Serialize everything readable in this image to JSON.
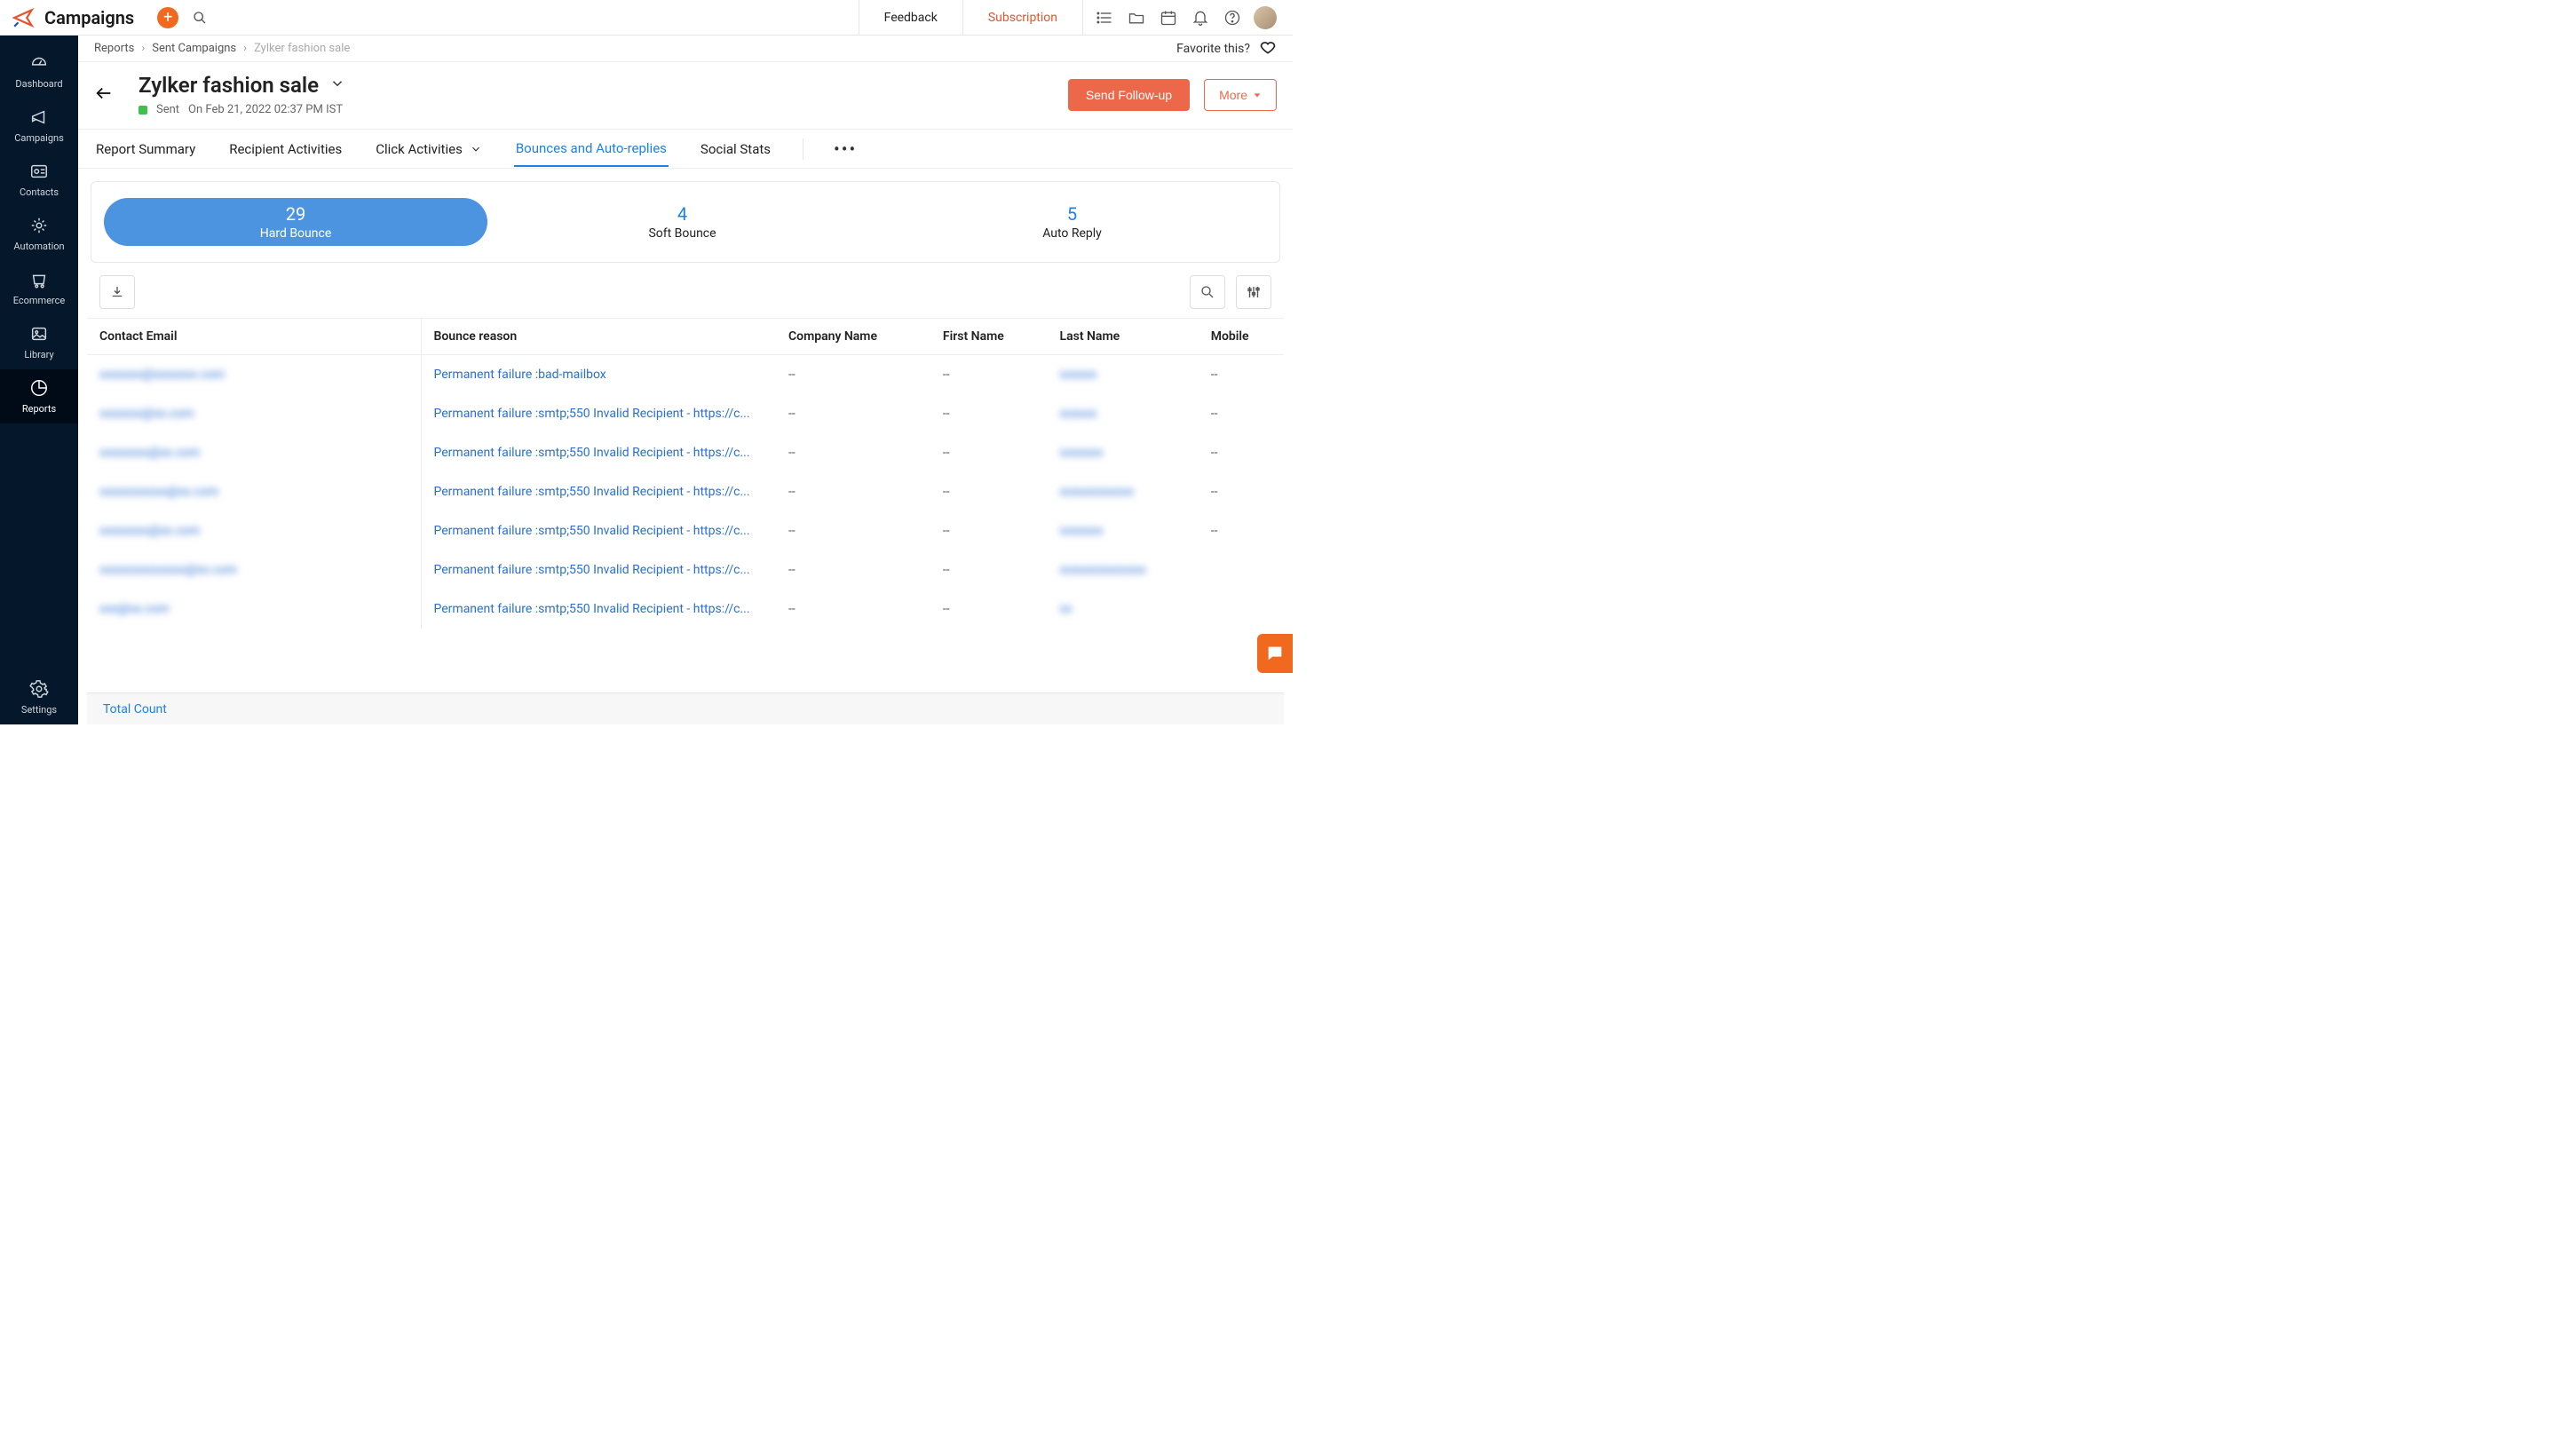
{
  "app_title": "Campaigns",
  "topbar": {
    "feedback": "Feedback",
    "subscription": "Subscription"
  },
  "sidebar": {
    "items": [
      {
        "label": "Dashboard"
      },
      {
        "label": "Campaigns"
      },
      {
        "label": "Contacts"
      },
      {
        "label": "Automation"
      },
      {
        "label": "Ecommerce"
      },
      {
        "label": "Library"
      },
      {
        "label": "Reports"
      }
    ],
    "settings": "Settings"
  },
  "breadcrumb": {
    "root": "Reports",
    "mid": "Sent Campaigns",
    "current": "Zylker fashion sale",
    "favorite": "Favorite this?"
  },
  "page": {
    "title": "Zylker fashion sale",
    "status_label": "Sent",
    "sent_time": "On Feb 21, 2022 02:37 PM IST",
    "send_followup": "Send Follow-up",
    "more": "More"
  },
  "tabs": [
    "Report Summary",
    "Recipient Activities",
    "Click Activities",
    "Bounces and Auto-replies",
    "Social Stats"
  ],
  "pills": [
    {
      "count": "29",
      "label": "Hard Bounce"
    },
    {
      "count": "4",
      "label": "Soft Bounce"
    },
    {
      "count": "5",
      "label": "Auto Reply"
    }
  ],
  "table": {
    "headers": {
      "email": "Contact Email",
      "reason": "Bounce reason",
      "company": "Company Name",
      "first": "First Name",
      "last": "Last Name",
      "mobile": "Mobile"
    },
    "rows": [
      {
        "email": "xxxxxxx@xxxxxxx.com",
        "reason": "Permanent failure :bad-mailbox",
        "company": "--",
        "first": "--",
        "last": "xxxxxx",
        "mobile": "--"
      },
      {
        "email": "xxxxxxx@xx.com",
        "reason": "Permanent failure :smtp;550 Invalid Recipient - https://c...",
        "company": "--",
        "first": "--",
        "last": "xxxxxx",
        "mobile": "--"
      },
      {
        "email": "xxxxxxxx@xx.com",
        "reason": "Permanent failure :smtp;550 Invalid Recipient - https://c...",
        "company": "--",
        "first": "--",
        "last": "xxxxxxx",
        "mobile": "--"
      },
      {
        "email": "xxxxxxxxxxx@xx.com",
        "reason": "Permanent failure :smtp;550 Invalid Recipient - https://c...",
        "company": "--",
        "first": "--",
        "last": "xxxxxxxxxxxx",
        "mobile": "--"
      },
      {
        "email": "xxxxxxxx@xx.com",
        "reason": "Permanent failure :smtp;550 Invalid Recipient - https://c...",
        "company": "--",
        "first": "--",
        "last": "xxxxxxx",
        "mobile": "--"
      },
      {
        "email": "xxxxxxxxxxxxxx@xx.com",
        "reason": "Permanent failure :smtp;550 Invalid Recipient - https://c...",
        "company": "--",
        "first": "--",
        "last": "xxxxxxxxxxxxxx",
        "mobile": ""
      },
      {
        "email": "xxx@xx.com",
        "reason": "Permanent failure :smtp;550 Invalid Recipient - https://c...",
        "company": "--",
        "first": "--",
        "last": "xx",
        "mobile": ""
      }
    ]
  },
  "footer": {
    "total": "Total Count"
  }
}
